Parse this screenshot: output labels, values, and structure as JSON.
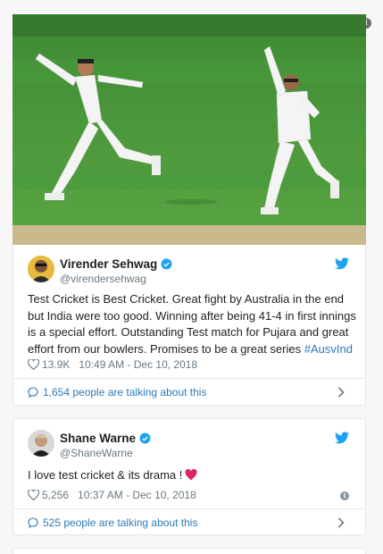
{
  "photo": {
    "alt": "Cricket players celebrating on the field"
  },
  "tweets": [
    {
      "name": "Virender Sehwag",
      "handle": "@virendersehwag",
      "text": "Test Cricket is Best Cricket. Great fight by Australia in the end but India were too good. Winning after being 41-4 in first innings is a special effort. Outstanding Test match for Pujara and great effort from our bowlers. Promises to be a great series ",
      "hashtag": "#AusvInd",
      "likes": "13.9K",
      "timestamp": "10:49 AM - Dec 10, 2018",
      "talking": "1,654 people are talking about this"
    },
    {
      "name": "Shane Warne",
      "handle": "@ShaneWarne",
      "text": "I love test cricket & its drama !",
      "likes": "5,256",
      "timestamp": "10:37 AM - Dec 10, 2018",
      "talking": "525 people are talking about this"
    }
  ],
  "colors": {
    "twitter_blue": "#1da1f2",
    "link_blue": "#2b7bb9",
    "heart_red": "#e0245e"
  }
}
